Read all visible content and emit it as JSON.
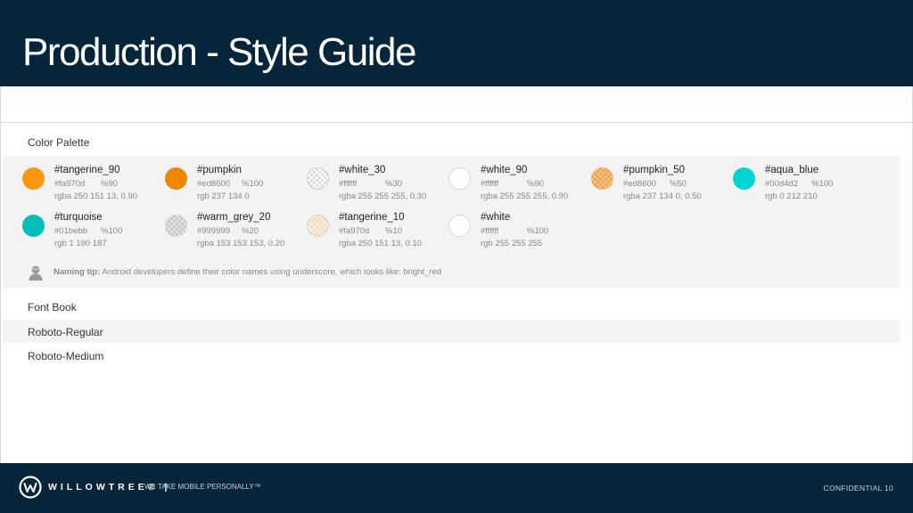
{
  "header": {
    "title": "Production - Style Guide"
  },
  "sections": {
    "palette_label": "Color Palette",
    "fontbook_label": "Font Book"
  },
  "swatches": [
    {
      "name": "#tangerine_90",
      "hex": "#fa970d",
      "pct": "%90",
      "rgb": "rgba 250 151 13, 0.90",
      "color": "#fa970d"
    },
    {
      "name": "#pumpkin",
      "hex": "#ed8600",
      "pct": "%100",
      "rgb": "rgb 237 134 0",
      "color": "#ed8600"
    },
    {
      "name": "#white_30",
      "hex": "#ffffff",
      "pct": "%30",
      "rgb": "rgba 255 255 255, 0.30",
      "color": "#ffffff"
    },
    {
      "name": "#white_90",
      "hex": "#ffffff",
      "pct": "%90",
      "rgb": "rgba 255 255 255, 0.90",
      "color": "#ffffff"
    },
    {
      "name": "#pumpkin_50",
      "hex": "#ed8600",
      "pct": "%50",
      "rgb": "rgba 237 134 0, 0.50",
      "color": "#ed8600"
    },
    {
      "name": "#aqua_blue",
      "hex": "#00d4d2",
      "pct": "%100",
      "rgb": "rgb 0 212 210",
      "color": "#00d4d2"
    },
    {
      "name": "#turquoise",
      "hex": "#01bebb",
      "pct": "%100",
      "rgb": "rgb 1 190 187",
      "color": "#01bebb"
    },
    {
      "name": "#warm_grey_20",
      "hex": "#999999",
      "pct": "%20",
      "rgb": "rgba 153 153 153, 0.20",
      "color": "#999999"
    },
    {
      "name": "#tangerine_10",
      "hex": "#fa970d",
      "pct": "%10",
      "rgb": "rgba 250 151 13, 0.10",
      "color": "#fa970d"
    },
    {
      "name": "#white",
      "hex": "#ffffff",
      "pct": "%100",
      "rgb": "rgb 255 255 255",
      "color": "#ffffff"
    }
  ],
  "tip": {
    "label": "Naming tip:",
    "text": "Android developers  define their color names using underscore, which looks like: bright_red",
    "icon": "user-icon"
  },
  "fonts": [
    "Roboto-Regular",
    "Roboto-Medium"
  ],
  "footer": {
    "brand": "WILLOWTREE® |",
    "tagline": "WE TAKE MOBILE PERSONALLY™",
    "confidential": "CONFIDENTIAL   10",
    "logo_icon": "willowtree-logo-icon"
  },
  "colors": {
    "header_bg": "#05263a",
    "panel_bg": "#f3f3f3"
  }
}
